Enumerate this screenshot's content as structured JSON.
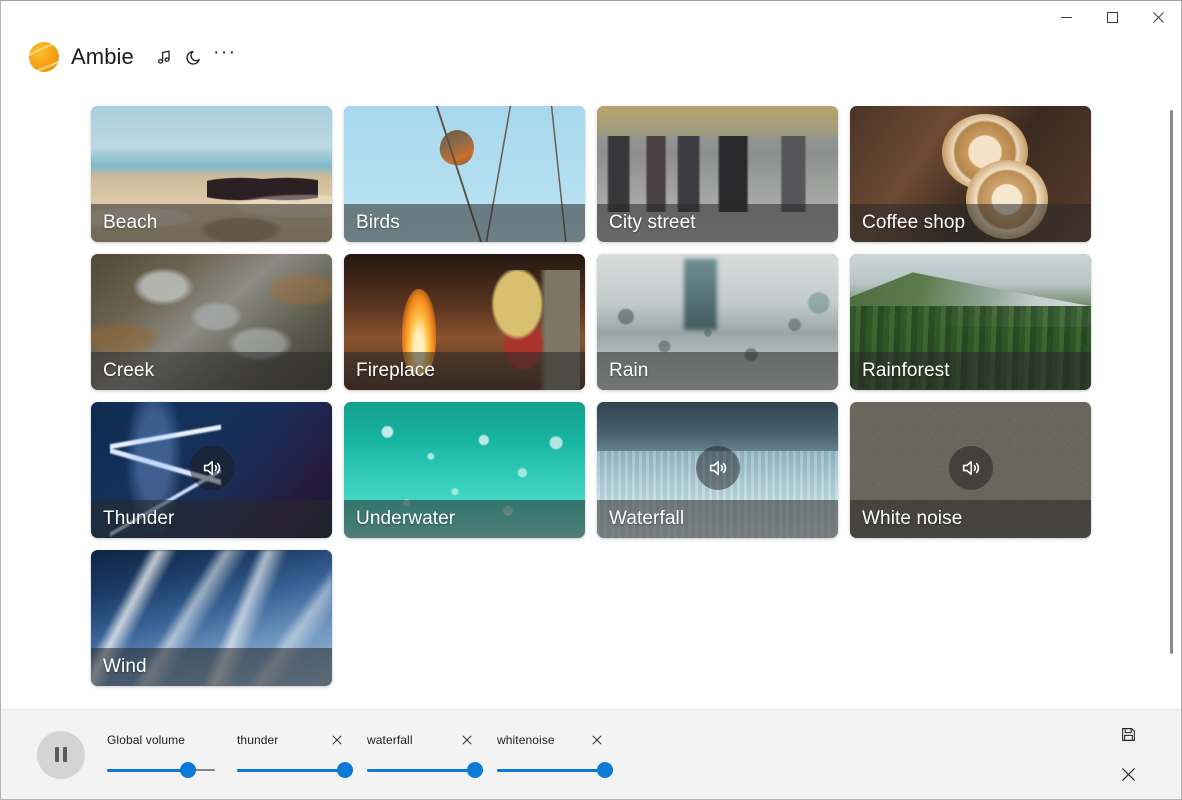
{
  "window": {
    "controls": [
      {
        "name": "minimize",
        "label": "Minimize"
      },
      {
        "name": "maximize",
        "label": "Maximize"
      },
      {
        "name": "close",
        "label": "Close"
      }
    ]
  },
  "header": {
    "app_title": "Ambie",
    "logo_icon": "ambie-sphere-logo",
    "actions": [
      {
        "icon": "music-note-icon",
        "label": "Music"
      },
      {
        "icon": "moon-icon",
        "label": "Sleep timer"
      },
      {
        "icon": "more-ellipsis-icon",
        "label": "More"
      }
    ]
  },
  "sounds": [
    {
      "name": "Beach",
      "art": "art-beach",
      "playing": false
    },
    {
      "name": "Birds",
      "art": "art-birds",
      "playing": false
    },
    {
      "name": "City street",
      "art": "art-city",
      "playing": false
    },
    {
      "name": "Coffee shop",
      "art": "art-coffee",
      "playing": false
    },
    {
      "name": "Creek",
      "art": "art-creek",
      "playing": false
    },
    {
      "name": "Fireplace",
      "art": "art-fireplace",
      "playing": false
    },
    {
      "name": "Rain",
      "art": "art-rain",
      "playing": false
    },
    {
      "name": "Rainforest",
      "art": "art-rainforest",
      "playing": false
    },
    {
      "name": "Thunder",
      "art": "art-thunder",
      "playing": true
    },
    {
      "name": "Underwater",
      "art": "art-underwater",
      "playing": false
    },
    {
      "name": "Waterfall",
      "art": "art-waterfall",
      "playing": true
    },
    {
      "name": "White noise",
      "art": "art-whitenoise",
      "playing": true
    },
    {
      "name": "Wind",
      "art": "art-wind",
      "playing": false
    }
  ],
  "player": {
    "transport": {
      "state": "paused",
      "icon": "pause-icon",
      "label": "Pause"
    },
    "sliders": [
      {
        "label": "Global volume",
        "value": 75,
        "removable": false
      },
      {
        "label": "thunder",
        "value": 100,
        "removable": true
      },
      {
        "label": "waterfall",
        "value": 100,
        "removable": true
      },
      {
        "label": "whitenoise",
        "value": 100,
        "removable": true
      }
    ],
    "actions": [
      {
        "icon": "save-icon",
        "label": "Save mix"
      },
      {
        "icon": "close-icon",
        "label": "Clear all"
      }
    ]
  },
  "colors": {
    "accent": "#0a7ad6",
    "logo": "#f6a416",
    "bar_background": "#f3f3f3",
    "page_background": "#ffffff"
  }
}
